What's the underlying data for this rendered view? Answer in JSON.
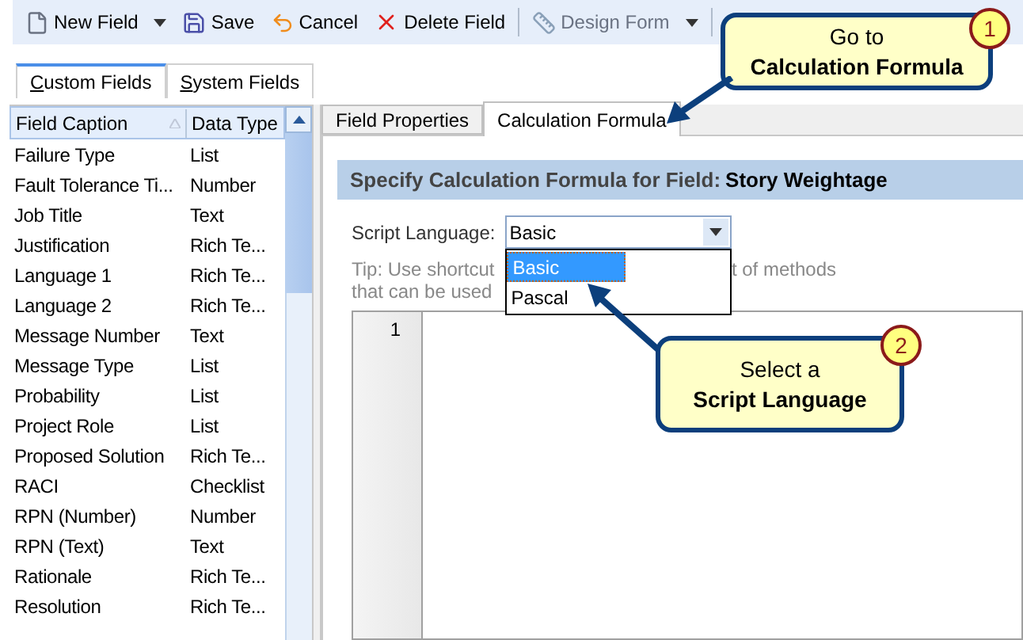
{
  "toolbar": [
    {
      "kind": "button",
      "label": "New Field"
    },
    {
      "kind": "caret"
    },
    {
      "kind": "button",
      "label": "Save"
    },
    {
      "kind": "button",
      "label": "Cancel"
    },
    {
      "kind": "button",
      "label": "Delete Field"
    },
    {
      "kind": "separator"
    },
    {
      "kind": "button",
      "label": "Design Form",
      "disabled": true
    },
    {
      "kind": "caret"
    },
    {
      "kind": "separator"
    }
  ],
  "left_tabs": [
    {
      "label": "Custom Fields",
      "selected": true
    },
    {
      "label": "System Fields",
      "selected": false
    }
  ],
  "grid": {
    "columns": [
      "Field Caption",
      "Data Type"
    ],
    "rows": [
      [
        "Failure Type",
        "List"
      ],
      [
        "Fault Tolerance Ti...",
        "Number"
      ],
      [
        "Job Title",
        "Text"
      ],
      [
        "Justification",
        "Rich Te..."
      ],
      [
        "Language 1",
        "Rich Te..."
      ],
      [
        "Language 2",
        "Rich Te..."
      ],
      [
        "Message Number",
        "Text"
      ],
      [
        "Message Type",
        "List"
      ],
      [
        "Probability",
        "List"
      ],
      [
        "Project Role",
        "List"
      ],
      [
        "Proposed Solution",
        "Rich Te..."
      ],
      [
        "RACI",
        "Checklist"
      ],
      [
        "RPN (Number)",
        "Number"
      ],
      [
        "RPN (Text)",
        "Text"
      ],
      [
        "Rationale",
        "Rich Te..."
      ],
      [
        "Resolution",
        "Rich Te..."
      ]
    ]
  },
  "right_tabs": [
    {
      "label": "Field Properties",
      "selected": false
    },
    {
      "label": "Calculation Formula",
      "selected": true
    }
  ],
  "heading": {
    "label": "Specify Calculation Formula for Field:",
    "field": "Story Weightage"
  },
  "script_language": {
    "label": "Script Language:",
    "value": "Basic",
    "expanded": true,
    "options": [
      {
        "label": "Basic",
        "selected": true
      },
      {
        "label": "Pascal",
        "selected": false
      }
    ]
  },
  "tip": [
    [
      "Tip: Use shortcut",
      "t of methods"
    ],
    [
      "that can be used"
    ]
  ],
  "editor": {
    "line_numbers": [
      "1"
    ]
  },
  "callouts": [
    {
      "number": "1",
      "line1": "Go to",
      "line2": "Calculation Formula"
    },
    {
      "number": "2",
      "line1": "Select a",
      "line2": "Script Language"
    }
  ]
}
